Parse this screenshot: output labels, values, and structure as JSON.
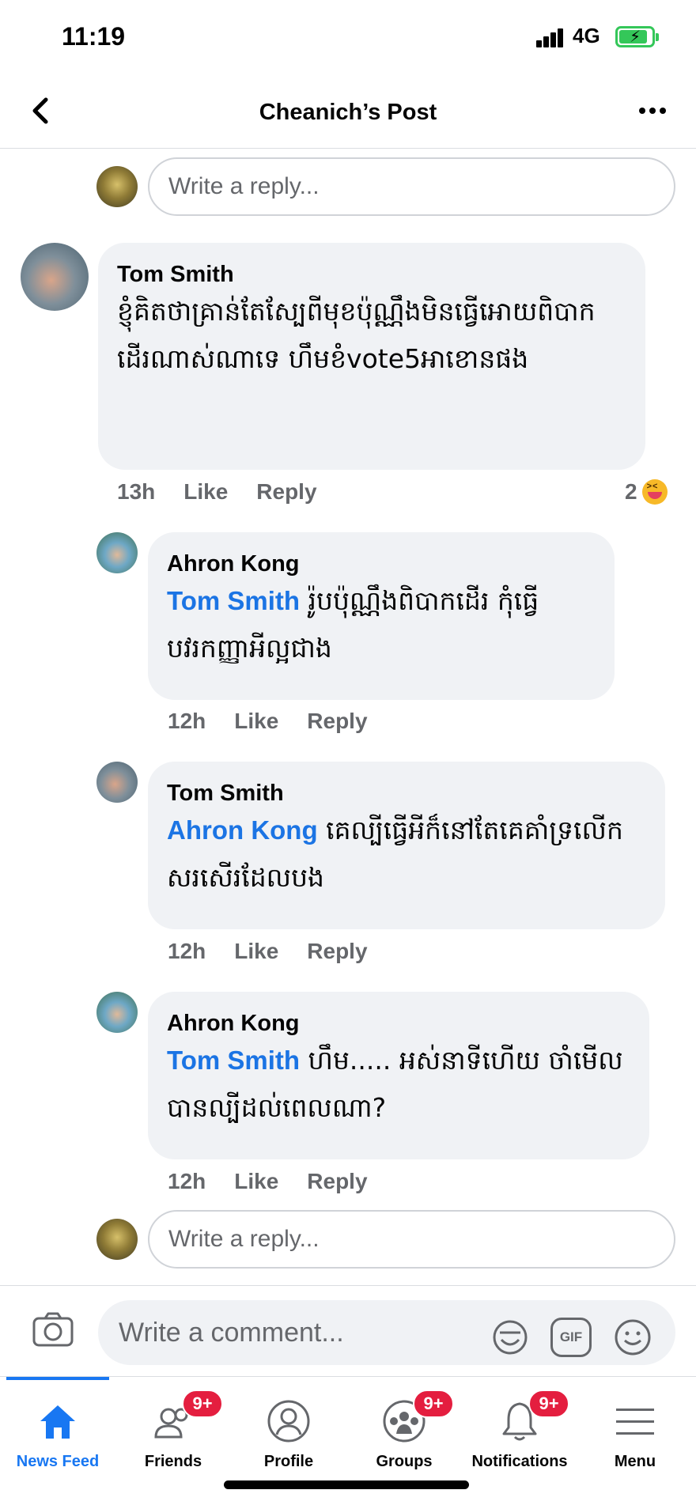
{
  "status_bar": {
    "time": "11:19",
    "network": "4G"
  },
  "header": {
    "title": "Cheanich’s Post"
  },
  "reply_top": {
    "placeholder": "Write a reply..."
  },
  "comments": [
    {
      "author": "Tom Smith",
      "text": "ខ្ញុំគិតថាគ្រាន់តែស្បែពីមុខប៉ុណ្ណឹងមិនធ្វើអោយពិបាកដើរណាស់ណាទេ ហឹមខំvote5អាខោនផង",
      "time": "13h",
      "like": "Like",
      "reply": "Reply",
      "reaction_count": "2"
    },
    {
      "author": "Ahron Kong",
      "mention": "Tom Smith",
      "text": "រ៉ូបប៉ុណ្ណឹងពិបាកដើរ កុំធ្វើបវរកញ្ញាអីល្អជាង",
      "time": "12h",
      "like": "Like",
      "reply": "Reply"
    },
    {
      "author": "Tom Smith",
      "mention": "Ahron Kong",
      "text": "គេល្បីធ្វើអីក៏នៅតែគេគាំទ្រលើកសរសើរដែលបង",
      "time": "12h",
      "like": "Like",
      "reply": "Reply"
    },
    {
      "author": "Ahron Kong",
      "mention": "Tom Smith",
      "text": "ហឹម..... អស់នាទីហើយ ចាំមើលបានល្បីដល់ពេលណា?",
      "time": "12h",
      "like": "Like",
      "reply": "Reply"
    }
  ],
  "reply_bottom": {
    "placeholder": "Write a reply..."
  },
  "composer": {
    "placeholder": "Write a comment...",
    "gif_label": "GIF"
  },
  "tabs": [
    {
      "label": "News Feed",
      "icon": "home-icon",
      "active": true
    },
    {
      "label": "Friends",
      "icon": "friends-icon",
      "badge": "9+"
    },
    {
      "label": "Profile",
      "icon": "profile-icon"
    },
    {
      "label": "Groups",
      "icon": "groups-icon",
      "badge": "9+"
    },
    {
      "label": "Notifications",
      "icon": "bell-icon",
      "badge": "9+"
    },
    {
      "label": "Menu",
      "icon": "menu-icon"
    }
  ],
  "colors": {
    "accent": "#1877f2",
    "mention": "#1b74e4",
    "badge": "#e41e3f",
    "bubble": "#f0f2f5",
    "battery": "#34c759"
  }
}
